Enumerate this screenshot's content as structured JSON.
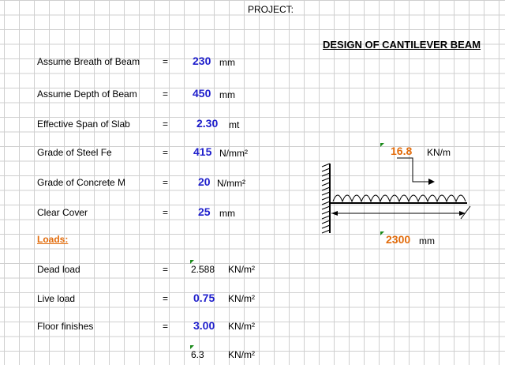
{
  "header": {
    "project_label": "PROJECT:"
  },
  "title": "DESIGN OF CANTILEVER BEAM",
  "rows": [
    {
      "label": "Assume Breath of Beam",
      "eq": "=",
      "value": "230",
      "unit": "mm"
    },
    {
      "label": "Assume Depth of Beam",
      "eq": "=",
      "value": "450",
      "unit": "mm"
    },
    {
      "label": "Effective Span of Slab",
      "eq": "=",
      "value": "2.30",
      "unit": "mt"
    },
    {
      "label": "Grade of Steel Fe",
      "eq": "=",
      "value": "415",
      "unit": "N/mm²"
    },
    {
      "label": "Grade of Concrete M",
      "eq": "=",
      "value": "20",
      "unit": "N/mm²"
    },
    {
      "label": "Clear Cover",
      "eq": "=",
      "value": "25",
      "unit": "mm"
    }
  ],
  "loads_heading": "Loads:",
  "loads": [
    {
      "label": "Dead load",
      "eq": "=",
      "value": "2.588",
      "unit": "KN/m²"
    },
    {
      "label": "Live load",
      "eq": "=",
      "value": "0.75",
      "unit": "KN/m²"
    },
    {
      "label": "Floor finishes",
      "eq": "=",
      "value": "3.00",
      "unit": "KN/m²"
    },
    {
      "label": "",
      "eq": "",
      "value": "6.3",
      "unit": "KN/m²"
    }
  ],
  "diagram": {
    "load_value": "16.8",
    "load_unit": "KN/m",
    "span_value": "2300",
    "span_unit": "mm"
  },
  "colors": {
    "value_blue": "#1f1fcc",
    "accent_orange": "#e26b0a",
    "comment_green": "#1a8a1a"
  }
}
